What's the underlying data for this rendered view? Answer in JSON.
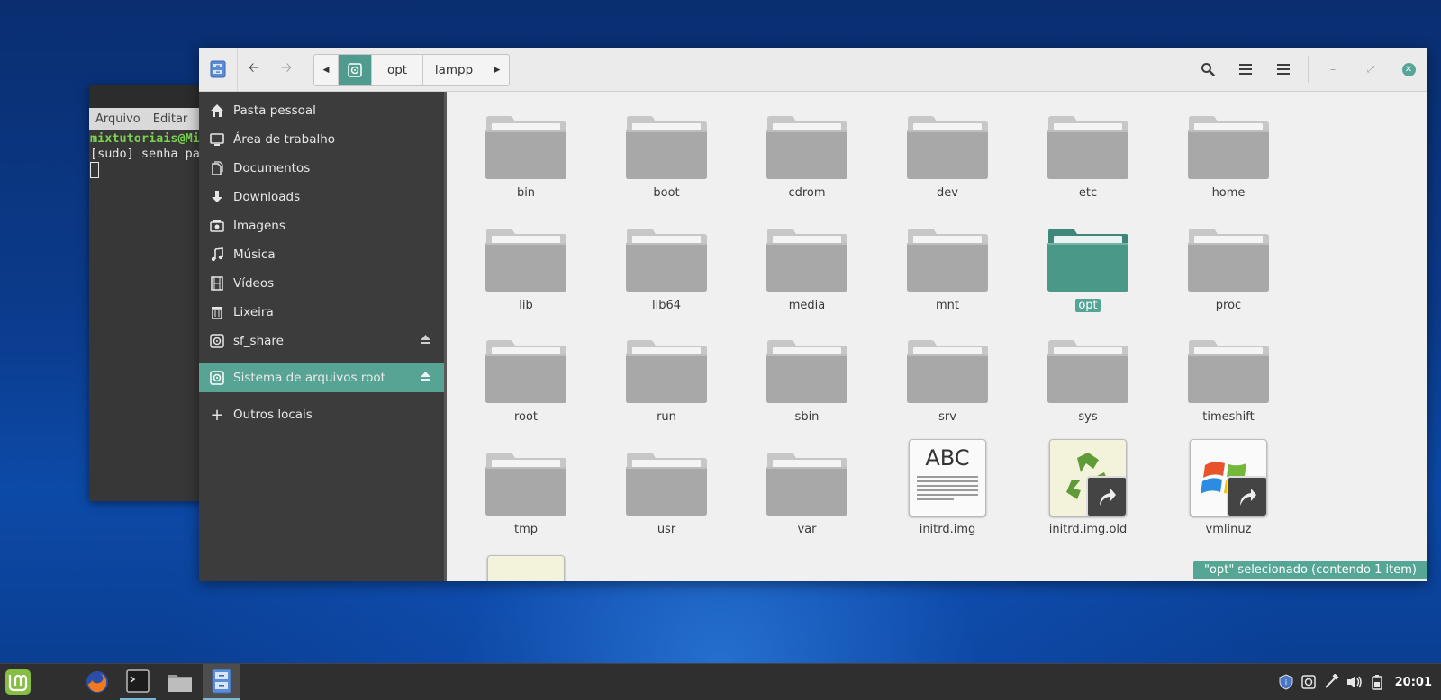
{
  "terminal": {
    "menu": [
      "Arquivo",
      "Editar"
    ],
    "lines": [
      {
        "prompt": "mixtutoriais@Mi",
        "rest": ""
      },
      {
        "prompt": "",
        "rest": "[sudo] senha pa"
      }
    ]
  },
  "file_manager": {
    "pathbar": {
      "segments": [
        "opt",
        "lampp"
      ]
    },
    "sidebar": {
      "items": [
        {
          "label": "Pasta pessoal",
          "icon": "home-icon"
        },
        {
          "label": "Área de trabalho",
          "icon": "desktop-icon"
        },
        {
          "label": "Documentos",
          "icon": "documents-icon"
        },
        {
          "label": "Downloads",
          "icon": "download-icon"
        },
        {
          "label": "Imagens",
          "icon": "pictures-icon"
        },
        {
          "label": "Música",
          "icon": "music-icon"
        },
        {
          "label": "Vídeos",
          "icon": "videos-icon"
        },
        {
          "label": "Lixeira",
          "icon": "trash-icon"
        },
        {
          "label": "sf_share",
          "icon": "drive-icon"
        },
        {
          "label": "Sistema de arquivos root",
          "icon": "drive-icon"
        },
        {
          "label": "Outros locais",
          "icon": "plus-icon"
        }
      ]
    },
    "items": [
      {
        "label": "bin",
        "kind": "folder"
      },
      {
        "label": "boot",
        "kind": "folder"
      },
      {
        "label": "cdrom",
        "kind": "folder"
      },
      {
        "label": "dev",
        "kind": "folder"
      },
      {
        "label": "etc",
        "kind": "folder"
      },
      {
        "label": "home",
        "kind": "folder"
      },
      {
        "label": "lib",
        "kind": "folder"
      },
      {
        "label": "lib64",
        "kind": "folder"
      },
      {
        "label": "media",
        "kind": "folder"
      },
      {
        "label": "mnt",
        "kind": "folder"
      },
      {
        "label": "opt",
        "kind": "folder",
        "selected": true
      },
      {
        "label": "proc",
        "kind": "folder"
      },
      {
        "label": "root",
        "kind": "folder"
      },
      {
        "label": "run",
        "kind": "folder"
      },
      {
        "label": "sbin",
        "kind": "folder"
      },
      {
        "label": "srv",
        "kind": "folder"
      },
      {
        "label": "sys",
        "kind": "folder"
      },
      {
        "label": "timeshift",
        "kind": "folder"
      },
      {
        "label": "tmp",
        "kind": "folder"
      },
      {
        "label": "usr",
        "kind": "folder"
      },
      {
        "label": "var",
        "kind": "folder"
      },
      {
        "label": "initrd.img",
        "kind": "text-file"
      },
      {
        "label": "initrd.img.old",
        "kind": "recycle-link"
      },
      {
        "label": "vmlinuz",
        "kind": "windows-link"
      }
    ],
    "text_thumb_heading": "ABC",
    "status": "\"opt\" selecionado  (contendo 1 item)",
    "colors": {
      "accent": "#56a696",
      "sidebar_bg": "#3c3c3c",
      "folder": "#a8a8a8"
    }
  },
  "taskbar": {
    "clock": "20:01",
    "apps": [
      "mint-menu-icon",
      "firefox-icon",
      "terminal-icon",
      "folder-icon",
      "file-manager-icon"
    ]
  }
}
